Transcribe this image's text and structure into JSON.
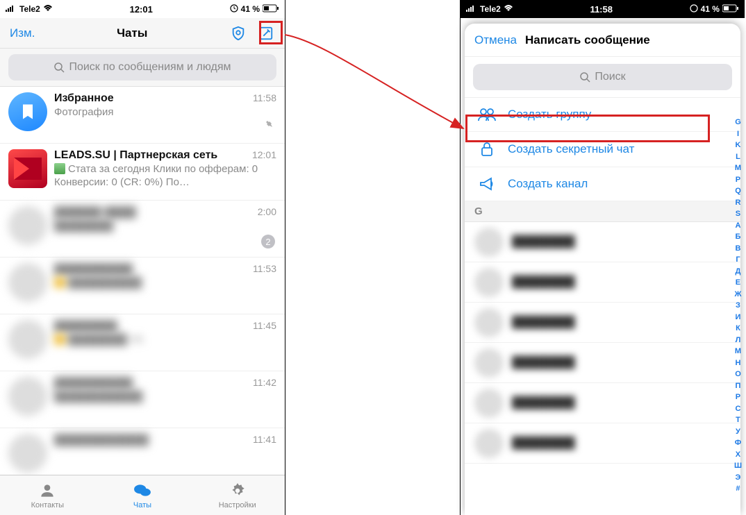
{
  "left": {
    "status": {
      "carrier": "Tele2",
      "time": "12:01",
      "battery": "41 %"
    },
    "nav": {
      "edit": "Изм.",
      "title": "Чаты"
    },
    "search": {
      "placeholder": "Поиск по сообщениям и людям"
    },
    "chats": [
      {
        "name": "Избранное",
        "msg": "Фотография",
        "time": "11:58",
        "pinned": true
      },
      {
        "name": "LEADS.SU | Партнерская сеть",
        "msg": "Стата за сегодня Клики по офферам: 0 Конверсии: 0 (CR: 0%) По…",
        "time": "12:01"
      },
      {
        "name": "",
        "msg": "",
        "time": "2:00",
        "badge": "2",
        "blur": true
      },
      {
        "name": "",
        "msg": "",
        "time": "11:53",
        "blur": true
      },
      {
        "name": "",
        "msg": "",
        "time": "11:45",
        "blur": true
      },
      {
        "name": "",
        "msg": "",
        "time": "11:42",
        "blur": true
      },
      {
        "name": "",
        "msg": "",
        "time": "11:41",
        "blur": true
      }
    ],
    "tabs": {
      "contacts": "Контакты",
      "chats": "Чаты",
      "settings": "Настройки"
    }
  },
  "right": {
    "status": {
      "carrier": "Tele2",
      "time": "11:58",
      "battery": "41 %"
    },
    "modal": {
      "cancel": "Отмена",
      "title": "Написать сообщение",
      "search": {
        "placeholder": "Поиск"
      },
      "options": {
        "group": "Создать группу",
        "secret": "Создать секретный чат",
        "channel": "Создать канал"
      },
      "section": "G",
      "index": [
        "G",
        "I",
        "K",
        "L",
        "M",
        "P",
        "Q",
        "R",
        "S",
        "А",
        "Б",
        "В",
        "Г",
        "Д",
        "Е",
        "Ж",
        "З",
        "И",
        "К",
        "Л",
        "М",
        "Н",
        "О",
        "П",
        "Р",
        "С",
        "Т",
        "У",
        "Ф",
        "Х",
        "Ш",
        "Э",
        "#"
      ]
    }
  }
}
